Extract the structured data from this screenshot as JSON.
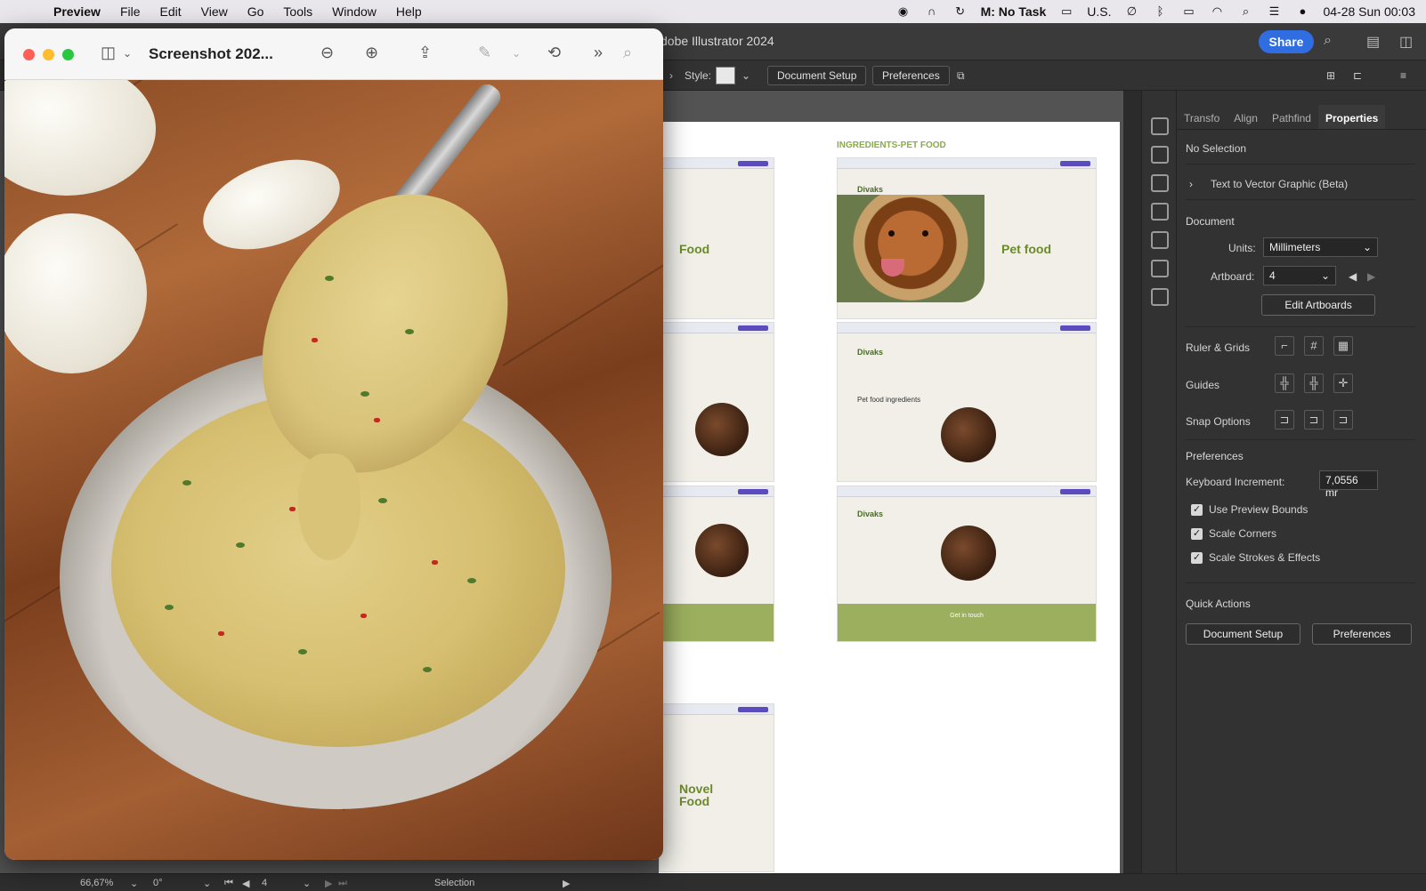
{
  "menubar": {
    "apple_icon": "apple-logo-icon",
    "app_name": "Preview",
    "menus": [
      "File",
      "Edit",
      "View",
      "Go",
      "Tools",
      "Window",
      "Help"
    ],
    "focus_status": "M: No Task",
    "keyboard_layout": "U.S.",
    "datetime": "04-28 Sun  00:03"
  },
  "illustrator": {
    "title": "dobe Illustrator 2024",
    "share_label": "Share",
    "control": {
      "style_label": "Style:",
      "document_setup": "Document Setup",
      "preferences": "Preferences"
    },
    "artboards": {
      "ingredients_title": "INGREDIENTS-PET FOOD",
      "logo": "Divaks",
      "food_heading": "Food",
      "pet_food_heading": "Pet food",
      "pet_food_ingredients": "Pet food ingredients",
      "get_in_touch": "Get in touch",
      "novel_food_heading": "Novel Food"
    },
    "panel": {
      "tabs": [
        "Transfo",
        "Align",
        "Pathfind",
        "Properties"
      ],
      "active_tab": "Properties",
      "no_selection": "No Selection",
      "text_to_vector": "Text to Vector Graphic (Beta)",
      "document_label": "Document",
      "units_label": "Units:",
      "units_value": "Millimeters",
      "artboard_label": "Artboard:",
      "artboard_value": "4",
      "edit_artboards": "Edit Artboards",
      "ruler_grids": "Ruler & Grids",
      "guides": "Guides",
      "snap_options": "Snap Options",
      "preferences_label": "Preferences",
      "keyboard_increment_label": "Keyboard Increment:",
      "keyboard_increment_value": "7,0556 mr",
      "use_preview_bounds": "Use Preview Bounds",
      "scale_corners": "Scale Corners",
      "scale_strokes": "Scale Strokes & Effects",
      "quick_actions": "Quick Actions",
      "qa_document_setup": "Document Setup",
      "qa_preferences": "Preferences"
    },
    "status": {
      "zoom": "66,67%",
      "rotation": "0°",
      "artboard_nav": "4",
      "tool": "Selection"
    }
  },
  "preview": {
    "title": "Screenshot 202..."
  },
  "colors": {
    "accent_blue": "#2f6de1",
    "brand_green": "#8aab4a",
    "traffic_red": "#ff5f57",
    "traffic_yellow": "#febc2e",
    "traffic_green": "#28c840"
  }
}
